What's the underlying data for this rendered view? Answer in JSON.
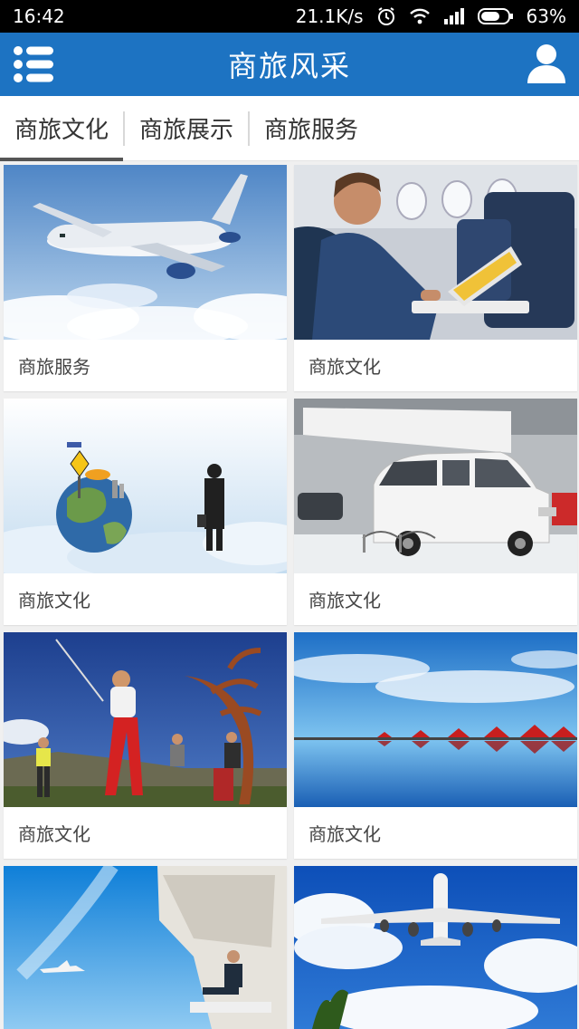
{
  "status": {
    "time": "16:42",
    "network_speed": "21.1K/s",
    "battery": "63%",
    "icons": [
      "alarm-icon",
      "wifi-icon",
      "signal-icon",
      "battery-icon"
    ]
  },
  "app_bar": {
    "title": "商旅风采",
    "menu_icon": "list-menu-icon",
    "user_icon": "user-icon",
    "background": "#1d73c2"
  },
  "tabs": [
    {
      "label": "商旅文化",
      "active": true
    },
    {
      "label": "商旅展示",
      "active": false
    },
    {
      "label": "商旅服务",
      "active": false
    }
  ],
  "cards": [
    {
      "caption": "商旅服务",
      "image": "airplane-over-clouds"
    },
    {
      "caption": "商旅文化",
      "image": "businessman-with-laptop-in-plane"
    },
    {
      "caption": "商旅文化",
      "image": "globe-and-businessman-on-clouds"
    },
    {
      "caption": "商旅文化",
      "image": "white-van-at-auto-show"
    },
    {
      "caption": "商旅文化",
      "image": "golfers-with-tree-sculpture"
    },
    {
      "caption": "商旅文化",
      "image": "red-huts-reflected-on-water"
    },
    {
      "caption": "",
      "image": "man-sitting-on-ship-deck-with-plane"
    },
    {
      "caption": "",
      "image": "airliner-under-blue-sky"
    }
  ]
}
